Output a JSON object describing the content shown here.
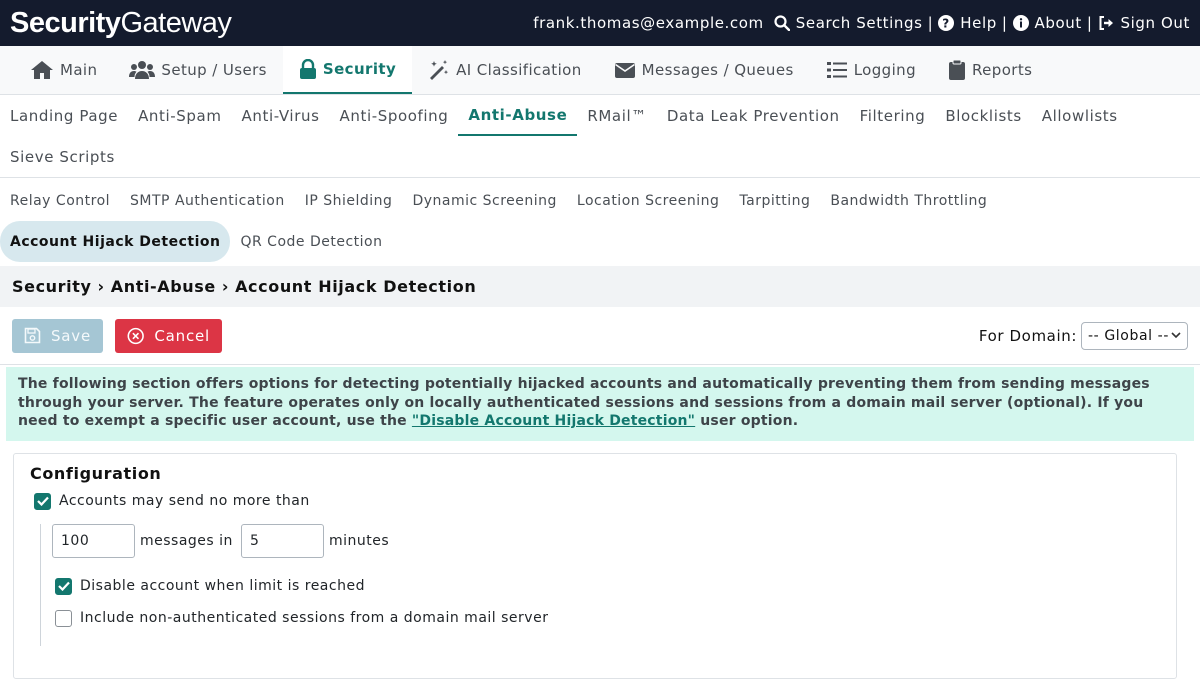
{
  "app": {
    "logo_bold": "Security",
    "logo_light": "Gateway"
  },
  "topbar": {
    "user": "frank.thomas@example.com",
    "search": "Search Settings",
    "help": "Help",
    "about": "About",
    "signout": "Sign Out",
    "separator": "|"
  },
  "mainnav": [
    {
      "label": "Main",
      "icon": "home-icon"
    },
    {
      "label": "Setup / Users",
      "icon": "users-icon"
    },
    {
      "label": "Security",
      "icon": "lock-icon"
    },
    {
      "label": "AI Classification",
      "icon": "magic-wand-icon"
    },
    {
      "label": "Messages / Queues",
      "icon": "envelope-icon"
    },
    {
      "label": "Logging",
      "icon": "list-icon"
    },
    {
      "label": "Reports",
      "icon": "clipboard-icon"
    }
  ],
  "subnav": [
    "Landing Page",
    "Anti-Spam",
    "Anti-Virus",
    "Anti-Spoofing",
    "Anti-Abuse",
    "RMail™",
    "Data Leak Prevention",
    "Filtering",
    "Blocklists",
    "Allowlists",
    "Sieve Scripts"
  ],
  "thirdnav": [
    "Relay Control",
    "SMTP Authentication",
    "IP Shielding",
    "Dynamic Screening",
    "Location Screening",
    "Tarpitting",
    "Bandwidth Throttling",
    "Account Hijack Detection",
    "QR Code Detection"
  ],
  "breadcrumb": {
    "parts": [
      "Security",
      "Anti-Abuse",
      "Account Hijack Detection"
    ],
    "sep": "›"
  },
  "toolbar": {
    "save": "Save",
    "cancel": "Cancel",
    "domain_label": "For Domain:",
    "domain_value": "-- Global --"
  },
  "info": {
    "text_before": "The following section offers options for detecting potentially hijacked accounts and automatically preventing them from sending messages through your server. The feature operates only on locally authenticated sessions and sessions from a domain mail server (optional). If you need to exempt a specific user account, use the ",
    "link": "\"Disable Account Hijack Detection\"",
    "text_after": " user option."
  },
  "config": {
    "title": "Configuration",
    "limit_label": "Accounts may send no more than",
    "limit_checked": true,
    "messages_value": "100",
    "messages_label": "messages in",
    "minutes_value": "5",
    "minutes_label": "minutes",
    "disable_label": "Disable account when limit is reached",
    "disable_checked": true,
    "include_label": "Include non-authenticated sessions from a domain mail server",
    "include_checked": false
  },
  "colors": {
    "accent": "#13776e",
    "topbar": "#141b2d",
    "info_bg": "#d4f7ee",
    "cancel": "#dc3545",
    "save": "#a5c6d4"
  }
}
